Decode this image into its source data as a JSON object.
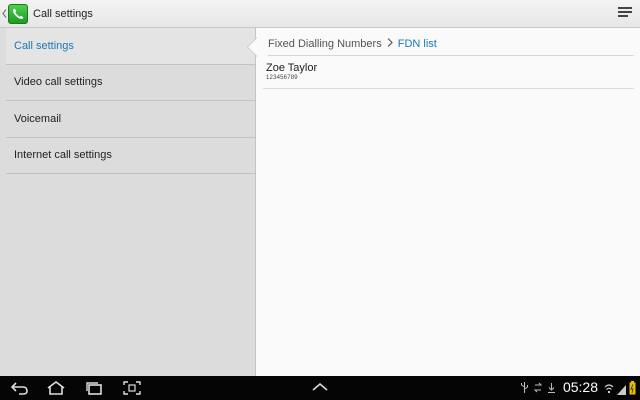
{
  "action_bar": {
    "title": "Call settings",
    "app_icon": "phone-icon",
    "menu_icon": "menu-icon"
  },
  "sidebar": {
    "items": [
      {
        "label": "Call settings",
        "selected": true
      },
      {
        "label": "Video call settings",
        "selected": false
      },
      {
        "label": "Voicemail",
        "selected": false
      },
      {
        "label": "Internet call settings",
        "selected": false
      }
    ]
  },
  "main": {
    "breadcrumb": {
      "parent": "Fixed Dialling Numbers",
      "separator": ">",
      "current": "FDN list"
    },
    "contacts": [
      {
        "name": "Zoe Taylor",
        "number": "123456789"
      }
    ]
  },
  "status_bar": {
    "time": "05:28",
    "icons": [
      "usb-icon",
      "sync-icon",
      "download-icon",
      "wifi-icon",
      "signal-icon",
      "battery-icon"
    ]
  },
  "nav_bar": {
    "icons": [
      "back-icon",
      "home-icon",
      "recent-apps-icon",
      "screenshot-icon",
      "up-arrow-icon"
    ]
  },
  "colors": {
    "accent": "#1b77b5",
    "sidebar_bg": "#dcdcdc",
    "content_bg": "#fafafa",
    "system_bar_bg": "#050505"
  }
}
